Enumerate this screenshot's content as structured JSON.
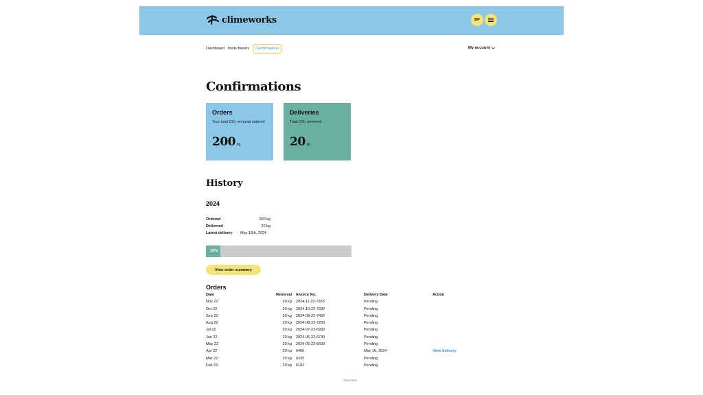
{
  "header": {
    "brand": "climeworks",
    "avatar_initials": "BP",
    "menu_icon": "hamburger-icon"
  },
  "nav": {
    "links": [
      "Dashboard",
      "Invite friends",
      "Confirmations"
    ],
    "active_index": 2,
    "account_label": "My account"
  },
  "page": {
    "title": "Confirmations"
  },
  "cards": {
    "orders": {
      "title": "Orders",
      "description": "Your total CO₂ removal ordered",
      "value": "200",
      "unit": "kg"
    },
    "deliveries": {
      "title": "Deliveries",
      "description": "Total CO₂ removed",
      "value": "20",
      "unit": "kg"
    }
  },
  "history": {
    "title": "History",
    "year": "2024",
    "ordered_label": "Ordered",
    "ordered_value": "200 kg",
    "delivered_label": "Delivered",
    "delivered_value": "20 kg",
    "latest_label": "Latest delivery",
    "latest_value": "May 16th, 2024",
    "progress_percent": 10,
    "progress_label": "10%",
    "summary_button": "View order summary"
  },
  "orders": {
    "title": "Orders",
    "columns": [
      "Date",
      "Removal",
      "Invoice No.",
      "Delivery Date",
      "Action"
    ],
    "rows": [
      [
        "Nov 22",
        "20 kg",
        "2024-11-22-7933",
        "Pending",
        ""
      ],
      [
        "Oct 22",
        "20 kg",
        "2024-10-22-7682",
        "Pending",
        ""
      ],
      [
        "Sep 22",
        "20 kg",
        "2024-09-22-7452",
        "Pending",
        ""
      ],
      [
        "Aug 22",
        "20 kg",
        "2024-08-22-7209",
        "Pending",
        ""
      ],
      [
        "Jul 22",
        "20 kg",
        "2024-07-22-6999",
        "Pending",
        ""
      ],
      [
        "Jun 22",
        "20 kg",
        "2024-06-22-6740",
        "Pending",
        ""
      ],
      [
        "May 22",
        "20 kg",
        "2024-05-22-6603",
        "Pending",
        ""
      ],
      [
        "Apr 22",
        "20 kg",
        "6466",
        "May 16, 2024",
        "View delivery"
      ],
      [
        "Mar 22",
        "20 kg",
        "6335",
        "Pending",
        ""
      ],
      [
        "Feb 22",
        "20 kg",
        "6182",
        "Pending",
        ""
      ]
    ],
    "show_less": "show less"
  },
  "colors": {
    "header_bg": "#8dc7e8",
    "deliveries_bg": "#69b2a3",
    "accent_yellow": "#f5e37a",
    "link_blue": "#3a8ed1"
  }
}
